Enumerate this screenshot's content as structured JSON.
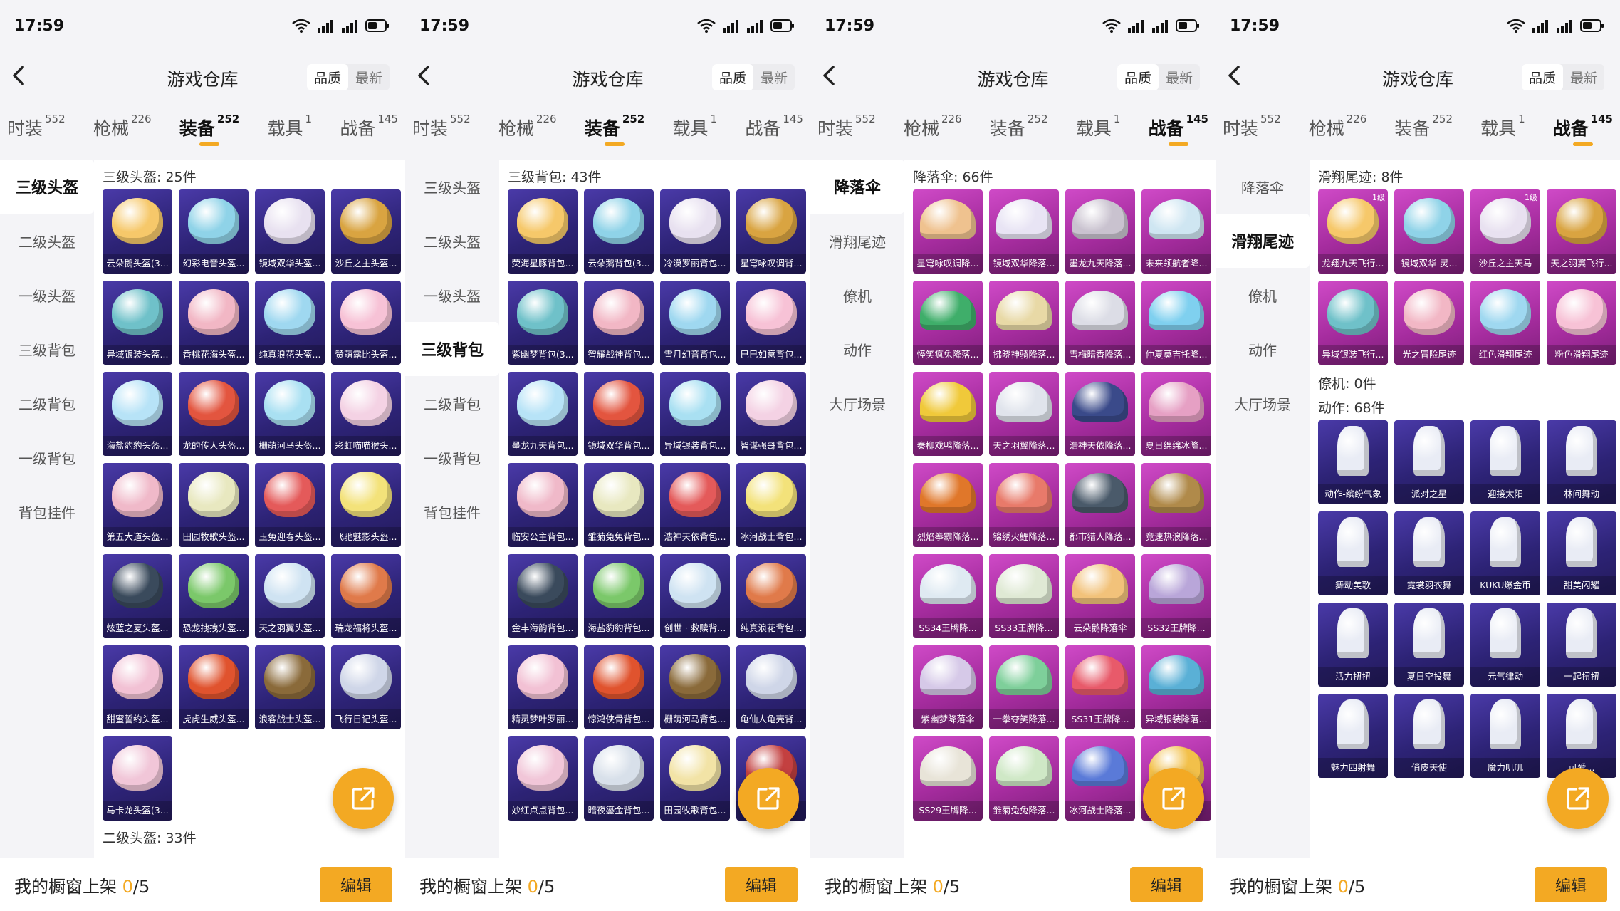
{
  "status": {
    "time": "17:59"
  },
  "header": {
    "title": "游戏仓库",
    "sort_quality": "品质",
    "sort_latest": "最新"
  },
  "tabs": [
    {
      "label": "时装",
      "count": "552"
    },
    {
      "label": "枪械",
      "count": "226"
    },
    {
      "label": "装备",
      "count": "252"
    },
    {
      "label": "载具",
      "count": "1"
    },
    {
      "label": "战备",
      "count": "145"
    }
  ],
  "footer": {
    "label": "我的橱窗上架 ",
    "count": "0",
    "total": "/5",
    "edit": "编辑"
  },
  "colors": {
    "accent": "#f3a923",
    "card_blue": "#2d2376",
    "card_pink": "#a52c9e"
  },
  "panels": [
    {
      "active_tab": 2,
      "side": [
        "三级头盔",
        "二级头盔",
        "一级头盔",
        "三级背包",
        "二级背包",
        "一级背包",
        "背包挂件"
      ],
      "active_side": 0,
      "sections": [
        {
          "title": "三级头盔: 25件",
          "style": "blue",
          "items": [
            "云朵鹅头盔(3...",
            "幻彩电音头盔...",
            "镜域双华头盔...",
            "沙丘之主头盔...",
            "异域银装头盔...",
            "香桃花海头盔...",
            "纯真浪花头盔...",
            "赞萌露比头盔...",
            "海盐豹豹头盔...",
            "龙的传人头盔...",
            "栅萌河马头盔...",
            "彩虹喵喵猴头...",
            "第五大道头盔...",
            "田园牧歌头盔...",
            "玉兔迎春头盔...",
            "飞驰魅影头盔...",
            "炫蓝之夏头盔...",
            "恐龙拽拽头盔...",
            "天之羽翼头盔...",
            "瑞龙福将头盔...",
            "甜蜜誓约头盔...",
            "虎虎生威头盔...",
            "浪客战士头盔...",
            "飞行日记头盔...",
            "马卡龙头盔(3..."
          ]
        }
      ],
      "cut_title": "二级头盔: 33件"
    },
    {
      "active_tab": 2,
      "side": [
        "三级头盔",
        "二级头盔",
        "一级头盔",
        "三级背包",
        "二级背包",
        "一级背包",
        "背包挂件"
      ],
      "active_side": 3,
      "sections": [
        {
          "title": "三级背包: 43件",
          "style": "blue",
          "items": [
            "荧海星豚背包...",
            "云朵鹅背包(3...",
            "冷漠罗丽背包...",
            "星穹咏叹调背...",
            "紫幽梦背包(3...",
            "智耀战神背包...",
            "雪月幻音背包...",
            "巳巳如意背包...",
            "墨龙九天背包...",
            "镜域双华背包...",
            "异域银装背包...",
            "智谋强哥背包...",
            "临安公主背包...",
            "雏菊兔兔背包...",
            "浩神天依背包...",
            "冰河战士背包...",
            "金丰海韵背包...",
            "海盐豹豹背包...",
            "创世 · 救赎背...",
            "纯真浪花背包...",
            "精灵梦叶罗丽...",
            "惊鸿侠骨背包...",
            "栅萌河马背包...",
            "龟仙人龟壳背...",
            "妙红点点背包...",
            "暗夜鎏金背包...",
            "田园牧歌背包...",
            "背包..."
          ]
        }
      ]
    },
    {
      "active_tab": 4,
      "side": [
        "降落伞",
        "滑翔尾迹",
        "僚机",
        "动作",
        "大厅场景"
      ],
      "active_side": 0,
      "sections": [
        {
          "title": "降落伞: 66件",
          "style": "pink",
          "items": [
            "星穹咏叹调降...",
            "镜域双华降落...",
            "墨龙九天降落...",
            "未来领航者降...",
            "怪笑疯兔降落...",
            "拂晓神骑降落...",
            "雪梅暗香降落...",
            "仲夏莫吉托降...",
            "秦柳戏鸭降落...",
            "天之羽翼降落...",
            "浩神天依降落...",
            "夏日绵绵冰降...",
            "烈焰拳霸降落...",
            "锦绣火鲤降落...",
            "都市猎人降落...",
            "竞速热浪降落...",
            "SS34王牌降...",
            "SS33王牌降...",
            "云朵鹅降落伞",
            "SS32王牌降...",
            "紫幽梦降落伞",
            "一拳夺笑降落...",
            "SS31王牌降...",
            "异域银装降落...",
            "SS29王牌降...",
            "雏菊兔兔降落...",
            "冰河战士降落...",
            "降落..."
          ]
        }
      ]
    },
    {
      "active_tab": 4,
      "side": [
        "降落伞",
        "滑翔尾迹",
        "僚机",
        "动作",
        "大厅场景"
      ],
      "active_side": 1,
      "sections": [
        {
          "title": "滑翔尾迹: 8件",
          "style": "pink",
          "items": [
            "龙翔九天飞行...",
            "镜域双华-灵...",
            "沙丘之主天马",
            "天之羽翼飞行...",
            "异域银装飞行...",
            "光之冒险尾迹",
            "红色滑翔尾迹",
            "粉色滑翔尾迹"
          ],
          "levels": [
            "1级",
            "",
            "1级",
            "",
            "",
            "",
            "",
            ""
          ]
        },
        {
          "title": "僚机: 0件",
          "style": "blue",
          "items": []
        },
        {
          "title": "动作: 68件",
          "style": "blue",
          "items": [
            "动作-缤纷气象",
            "派对之星",
            "迎接太阳",
            "林间舞动",
            "舞动美歌",
            "霓裳羽衣舞",
            "KUKU爆金币",
            "甜美闪耀",
            "活力扭扭",
            "夏日空投舞",
            "元气律动",
            "一起扭扭",
            "魅力四射舞",
            "俏皮天使",
            "魔力叽叽",
            "可爱..."
          ]
        }
      ]
    }
  ]
}
